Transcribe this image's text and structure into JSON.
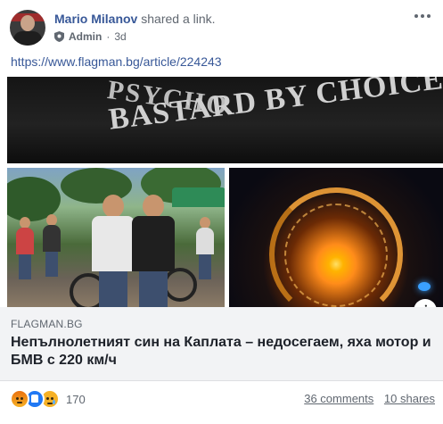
{
  "post": {
    "author": "Mario Milanov",
    "action": "shared a link.",
    "role": "Admin",
    "separator": "·",
    "time": "3d",
    "url_text": "https://www.flagman.bg/article/224243"
  },
  "image": {
    "top_line1": "PSYCHO",
    "top_line2": "BASTARD BY CHOICE",
    "info_label": "i"
  },
  "link_preview": {
    "domain": "FLAGMAN.BG",
    "headline": "Непълнолетният син на Каплата – недосегаем, яха мотор и БМВ с 220 км/ч"
  },
  "footer": {
    "reactions": [
      "angry-icon",
      "like-icon",
      "sad-icon"
    ],
    "reaction_count": "170",
    "comments": "36 comments",
    "shares": "10 shares"
  },
  "colors": {
    "author": "#385898",
    "secondary": "#606770",
    "preview_bg": "#f2f3f5",
    "like": "#2078f4",
    "angry": "#e9710f",
    "sad": "#f7b125"
  }
}
